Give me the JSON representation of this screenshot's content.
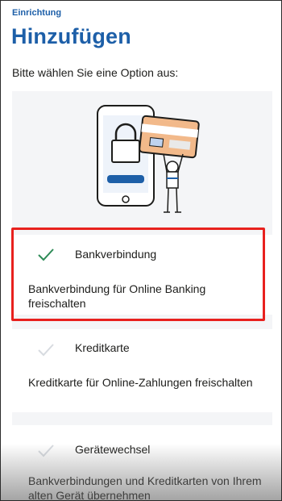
{
  "header": {
    "overline": "Einrichtung",
    "title": "Hinzufügen",
    "subtitle": "Bitte wählen Sie eine Option aus:"
  },
  "options": [
    {
      "title": "Bankverbindung",
      "description": "Bankverbindung für Online Banking freischalten",
      "check_color": "#2e8b57"
    },
    {
      "title": "Kreditkarte",
      "description": "Kreditkarte für Online-Zahlungen freischalten",
      "check_color": "#d7dbe0"
    },
    {
      "title": "Gerätewechsel",
      "description": "Bankverbindungen und Kreditkarten von Ihrem alten Gerät übernehmen",
      "check_color": "#d7dbe0"
    }
  ],
  "colors": {
    "accent": "#1d5fa8",
    "highlight": "#e8211e"
  },
  "illustration": {
    "icon": "phone-lock-credit-card-icon"
  }
}
